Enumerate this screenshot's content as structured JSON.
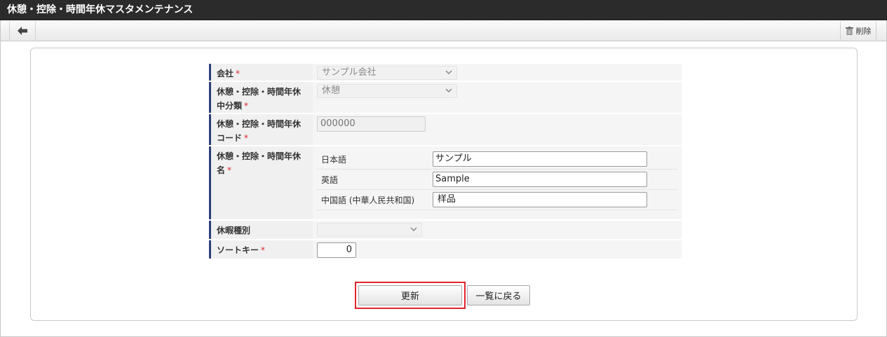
{
  "title": "休憩・控除・時間年休マスタメンテナンス",
  "toolbar": {
    "delete_label": "削除"
  },
  "form": {
    "company": {
      "label": "会社",
      "required": "*",
      "value": "サンプル会社"
    },
    "category": {
      "label_line1": "休憩・控除・時間年休",
      "label_line2": "中分類",
      "required": "*",
      "value": "休憩"
    },
    "code": {
      "label_line1": "休憩・控除・時間年休",
      "label_line2": "コード",
      "required": "*",
      "value": "000000"
    },
    "name": {
      "label_line1": "休憩・控除・時間年休",
      "label_line2": "名",
      "required": "*",
      "languages": [
        {
          "label": "日本語",
          "value": "サンプル"
        },
        {
          "label": "英語",
          "value": "Sample"
        },
        {
          "label": "中国語 (中華人民共和国)",
          "value": "样品"
        }
      ]
    },
    "leave_type": {
      "label": "休暇種別",
      "value": ""
    },
    "sort_key": {
      "label": "ソートキー",
      "required": "*",
      "value": "0"
    }
  },
  "buttons": {
    "update": "更新",
    "back_to_list": "一覧に戻る"
  }
}
